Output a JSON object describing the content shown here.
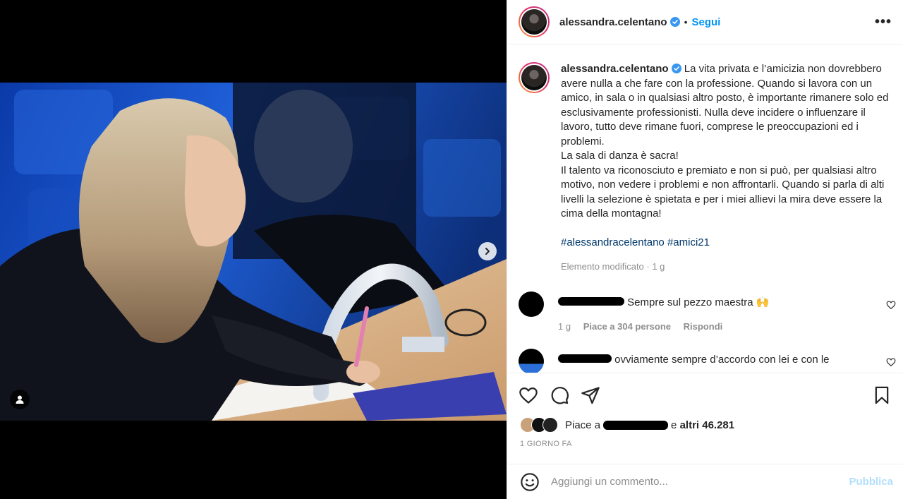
{
  "post": {
    "username": "alessandra.celentano",
    "follow_label": "Segui",
    "more_label": "•••",
    "dot_separator": "•"
  },
  "caption": {
    "username": "alessandra.celentano",
    "text": "La vita privata e l’amicizia non dovrebbero avere nulla a che fare con la professione. Quando si lavora con un amico, in sala o in qualsiasi altro posto, è importante rimanere solo ed esclusivamente professionisti. Nulla deve incidere o influenzare il lavoro, tutto deve rimane fuori, comprese le preoccupazioni ed i problemi.\nLa sala di danza è sacra!\nIl talento va riconosciuto e premiato e non si può, per qualsiasi altro motivo, non vedere i problemi e non affrontarli. Quando si parla di alti livelli la selezione è spietata e per i miei allievi la mira deve essere la cima della montagna!",
    "hashtags": [
      "#alessandracelentano",
      "#amici21"
    ],
    "meta": "Elemento modificato · 1 g"
  },
  "comments": [
    {
      "text": "Sempre sul pezzo maestra 🙌",
      "time": "1 g",
      "likes": "Piace a 304 persone",
      "reply": "Rispondi"
    },
    {
      "text": "ovviamente sempre d’accordo con lei e con le"
    }
  ],
  "likes": {
    "prefix": "Piace a",
    "suffix_e": "e",
    "others": "altri 46.281"
  },
  "time_ago": "1 GIORNO FA",
  "add_comment": {
    "placeholder": "Aggiungi un commento...",
    "publish_label": "Pubblica"
  },
  "colors": {
    "accent": "#0095f6",
    "hashtag": "#00376b",
    "muted": "#8e8e8e",
    "publish_disabled": "#b2dffc"
  }
}
